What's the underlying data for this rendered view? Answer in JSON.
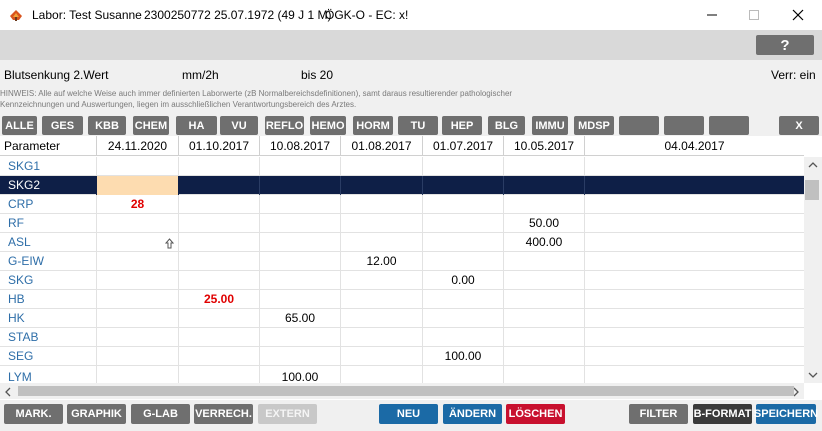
{
  "window": {
    "app_name": "Labor: Test Susanne",
    "patient_info": "2300250772 25.07.1972 (49 J 1 M)",
    "insurance": "ÖGK-O - EC: x!",
    "minimize": "—",
    "maximize": "☐",
    "close": "✕"
  },
  "toolbar": {
    "help_label": "?"
  },
  "info": {
    "parameter_name": "Blutsenkung 2.Wert",
    "unit": "mm/2h",
    "range": "bis 20",
    "verr": "Verr: ein",
    "hinweis": "HINWEIS: Alle auf welche Weise auch immer definierten Laborwerte (zB Normalbereichsdefinitionen), samt daraus resultierender pathologischer Kennzeichnungen und Auswertungen, liegen im ausschließlichen Verantwortungsbereich des Arztes."
  },
  "categories": [
    "ALLE",
    "GES",
    "KBB",
    "CHEM",
    "HA",
    "VU",
    "REFLO",
    "HEMO",
    "HORM",
    "TU",
    "HEP",
    "BLG",
    "IMMU",
    "MDSP",
    "",
    "",
    "",
    "X"
  ],
  "grid": {
    "header": [
      "Parameter",
      "24.11.2020",
      "01.10.2017",
      "10.08.2017",
      "01.08.2017",
      "01.07.2017",
      "10.05.2017",
      "04.04.2017"
    ],
    "rows": [
      {
        "name": "SKG1",
        "values": [
          "",
          "",
          "",
          "",
          "",
          "",
          ""
        ]
      },
      {
        "name": "SKG2",
        "values": [
          "",
          "",
          "",
          "",
          "",
          "",
          ""
        ]
      },
      {
        "name": "CRP",
        "values": [
          "28",
          "",
          "",
          "",
          "",
          "",
          ""
        ]
      },
      {
        "name": "RF",
        "values": [
          "",
          "",
          "",
          "",
          "",
          "50.00",
          ""
        ]
      },
      {
        "name": "ASL",
        "values": [
          "",
          "",
          "",
          "",
          "",
          "400.00",
          ""
        ]
      },
      {
        "name": "G-EIW",
        "values": [
          "",
          "",
          "",
          "12.00",
          "",
          "",
          ""
        ]
      },
      {
        "name": "SKG",
        "values": [
          "",
          "",
          "",
          "",
          "0.00",
          "",
          ""
        ]
      },
      {
        "name": "HB",
        "values": [
          "",
          "25.00",
          "",
          "",
          "",
          "",
          ""
        ]
      },
      {
        "name": "HK",
        "values": [
          "",
          "",
          "65.00",
          "",
          "",
          "",
          ""
        ]
      },
      {
        "name": "STAB",
        "values": [
          "",
          "",
          "",
          "",
          "",
          "",
          ""
        ]
      },
      {
        "name": "SEG",
        "values": [
          "",
          "",
          "",
          "",
          "100.00",
          "",
          ""
        ]
      },
      {
        "name": "LYM",
        "values": [
          "",
          "",
          "100.00",
          "",
          "",
          "",
          ""
        ]
      }
    ]
  },
  "bottom": {
    "mark": "MARK.",
    "graphik": "GRAPHIK",
    "glab": "G-LAB",
    "verrech": "VERRECH.",
    "extern": "EXTERN",
    "neu": "NEU",
    "aendern": "ÄNDERN",
    "loeschen": "LÖSCHEN",
    "filter": "FILTER",
    "bformat": "B-FORMAT",
    "speichern": "SPEICHERN"
  }
}
